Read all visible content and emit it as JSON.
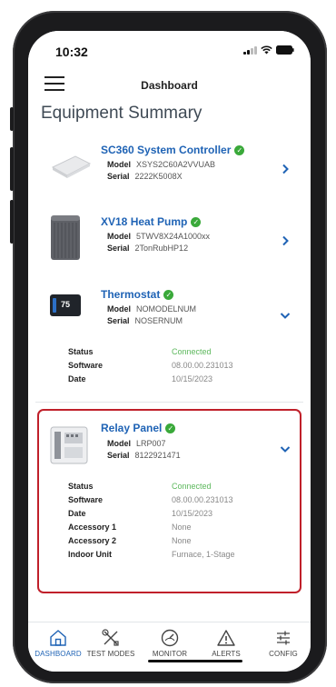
{
  "status_bar": {
    "time": "10:32"
  },
  "app_bar": {
    "title": "Dashboard"
  },
  "section_title": "Equipment Summary",
  "equipment": [
    {
      "name": "SC360 System Controller",
      "model_label": "Model",
      "model": "XSYS2C60A2VVUAB",
      "serial_label": "Serial",
      "serial": "2222K5008X",
      "chevron": "chevron-right-icon"
    },
    {
      "name": "XV18 Heat Pump",
      "model_label": "Model",
      "model": "5TWV8X24A1000xx",
      "serial_label": "Serial",
      "serial": "2TonRubHP12",
      "chevron": "chevron-right-icon"
    },
    {
      "name": "Thermostat",
      "thumb_text": "75",
      "model_label": "Model",
      "model": "NOMODELNUM",
      "serial_label": "Serial",
      "serial": "NOSERNUM",
      "chevron": "chevron-down-icon",
      "details": [
        {
          "label": "Status",
          "value": "Connected"
        },
        {
          "label": "Software",
          "value": "08.00.00.231013"
        },
        {
          "label": "Date",
          "value": "10/15/2023"
        }
      ]
    },
    {
      "name": "Relay Panel",
      "model_label": "Model",
      "model": "LRP007",
      "serial_label": "Serial",
      "serial": "8122921471",
      "chevron": "chevron-down-icon",
      "details": [
        {
          "label": "Status",
          "value": "Connected"
        },
        {
          "label": "Software",
          "value": "08.00.00.231013"
        },
        {
          "label": "Date",
          "value": "10/15/2023"
        },
        {
          "label": "Accessory 1",
          "value": "None"
        },
        {
          "label": "Accessory 2",
          "value": "None"
        },
        {
          "label": "Indoor Unit",
          "value": "Furnace, 1-Stage"
        }
      ]
    }
  ],
  "tabs": [
    {
      "label": "DASHBOARD",
      "icon": "home-icon",
      "active": true
    },
    {
      "label": "TEST MODES",
      "icon": "tools-icon",
      "active": false
    },
    {
      "label": "MONITOR",
      "icon": "gauge-icon",
      "active": false
    },
    {
      "label": "ALERTS",
      "icon": "alert-triangle-icon",
      "active": false
    },
    {
      "label": "CONFIG",
      "icon": "sliders-icon",
      "active": false
    }
  ],
  "colors": {
    "accent": "#1f63b5",
    "ok": "#5cb85c",
    "check": "#3aa93a",
    "highlight": "#c0202a"
  }
}
